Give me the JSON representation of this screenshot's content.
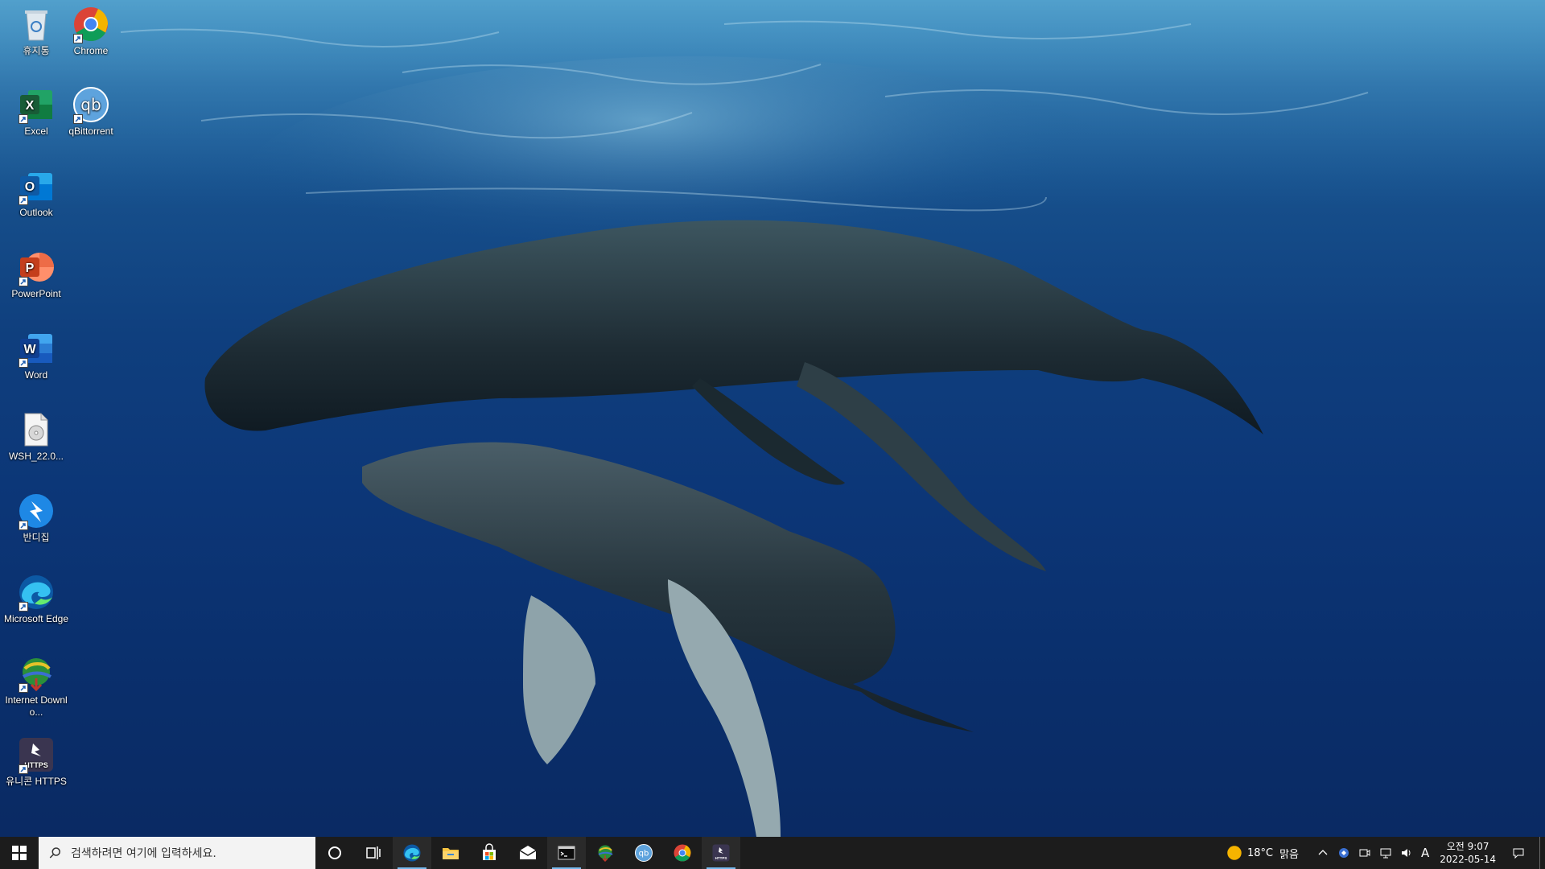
{
  "desktop": {
    "icons": [
      {
        "label": "휴지통",
        "icon": "recycle-bin-icon"
      },
      {
        "label": "Chrome",
        "icon": "chrome-icon"
      },
      {
        "label": "Excel",
        "icon": "excel-icon"
      },
      {
        "label": "qBittorrent",
        "icon": "qbittorrent-icon"
      },
      {
        "label": "Outlook",
        "icon": "outlook-icon"
      },
      {
        "label": "PowerPoint",
        "icon": "powerpoint-icon"
      },
      {
        "label": "Word",
        "icon": "word-icon"
      },
      {
        "label": "WSH_22.0...",
        "icon": "disc-image-file-icon"
      },
      {
        "label": "반디집",
        "icon": "bandizip-icon"
      },
      {
        "label": "Microsoft Edge",
        "icon": "edge-icon"
      },
      {
        "label": "Internet Downlo...",
        "icon": "internet-download-manager-icon"
      },
      {
        "label": "유니콘 HTTPS",
        "icon": "unicorn-https-icon"
      }
    ]
  },
  "taskbar": {
    "search_placeholder": "검색하려면 여기에 입력하세요.",
    "pinned": [
      {
        "name": "edge",
        "icon": "edge-icon",
        "active": true
      },
      {
        "name": "file-explorer",
        "icon": "folder-icon",
        "active": false
      },
      {
        "name": "microsoft-store",
        "icon": "store-icon",
        "active": false
      },
      {
        "name": "mail",
        "icon": "mail-icon",
        "active": false
      },
      {
        "name": "terminal",
        "icon": "terminal-icon",
        "active": true
      },
      {
        "name": "internet-download-manager",
        "icon": "internet-download-manager-icon",
        "active": false
      },
      {
        "name": "qbittorrent",
        "icon": "qbittorrent-icon",
        "active": false
      },
      {
        "name": "chrome",
        "icon": "chrome-icon",
        "active": false
      },
      {
        "name": "unicorn-https",
        "icon": "unicorn-https-icon",
        "active": true
      }
    ],
    "weather": {
      "temperature": "18°C",
      "condition": "맑음"
    },
    "ime_indicator": "A",
    "clock": {
      "time": "오전 9:07",
      "date": "2022-05-14"
    }
  },
  "colors": {
    "taskbar_bg": "#1c1c1c",
    "accent": "#76b9ed"
  }
}
